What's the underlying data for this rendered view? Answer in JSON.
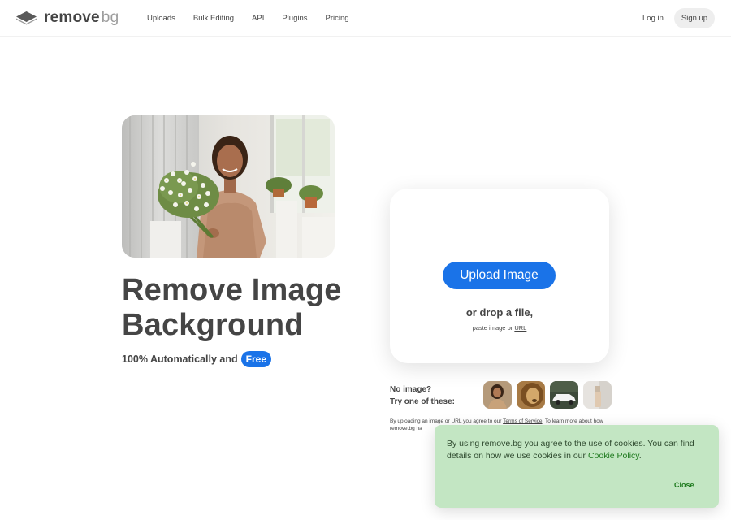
{
  "header": {
    "logo_main": "remove",
    "logo_suffix": "bg",
    "nav": [
      "Uploads",
      "Bulk Editing",
      "API",
      "Plugins",
      "Pricing"
    ],
    "login_label": "Log in",
    "signup_label": "Sign up"
  },
  "hero": {
    "title": "Remove Image Background",
    "subtitle_prefix": "100% Automatically and",
    "free_badge": "Free"
  },
  "upload": {
    "button_label": "Upload Image",
    "drop_text": "or drop a file,",
    "paste_prefix": "paste image or",
    "url_label": "URL"
  },
  "samples": {
    "line1": "No image?",
    "line2": "Try one of these:",
    "items": [
      "woman-portrait",
      "lion",
      "car",
      "cosmetic-bottle"
    ]
  },
  "tos": {
    "prefix": "By uploading an image or URL you agree to our",
    "link": "Terms of Service",
    "suffix": ". To learn more about how remove.bg ha"
  },
  "cookie": {
    "text": "By using remove.bg you agree to the use of cookies. You can find details on how we use cookies in our",
    "policy_link": "Cookie Policy",
    "period": ".",
    "close_label": "Close"
  },
  "colors": {
    "accent": "#1a73e8",
    "text": "#454545",
    "cookie_bg": "#c3e6c3",
    "cookie_link": "#1e7a1e"
  }
}
